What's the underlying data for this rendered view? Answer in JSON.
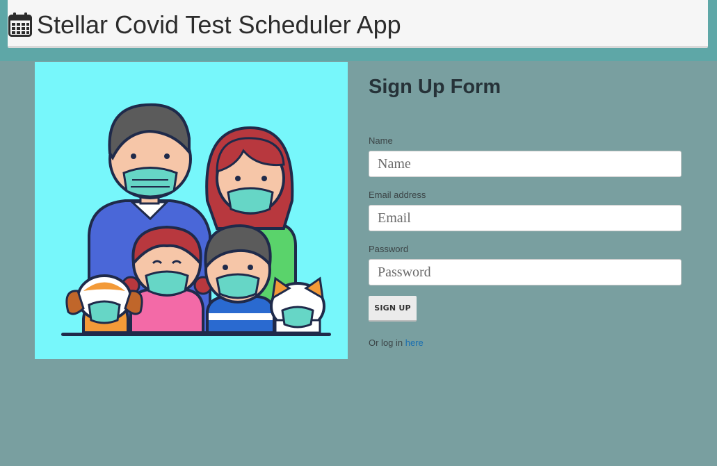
{
  "header": {
    "title": "Stellar Covid Test Scheduler App",
    "icon": "calendar-icon"
  },
  "illustration": {
    "subject": "family-with-masks-illustration",
    "background": "#77f7fb"
  },
  "form": {
    "title": "Sign Up Form",
    "name": {
      "label": "Name",
      "placeholder": "Name"
    },
    "email": {
      "label": "Email address",
      "placeholder": "Email"
    },
    "password": {
      "label": "Password",
      "placeholder": "Password"
    },
    "submit_label": "SIGN UP",
    "login_prefix": "Or log in",
    "login_link": "here"
  },
  "colors": {
    "page_bg": "#799fa0",
    "header_strip": "#5ea7a7",
    "navbar_bg": "#f6f6f6",
    "link": "#1a6fb0"
  }
}
